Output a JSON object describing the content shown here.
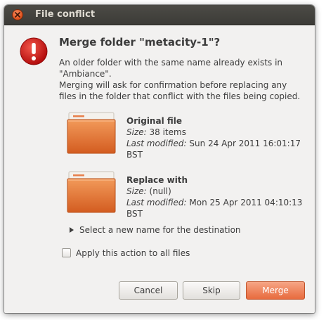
{
  "window": {
    "title": "File conflict"
  },
  "dialog": {
    "heading": "Merge folder \"metacity-1\"?",
    "message_line1": "An older folder with the same name already exists in \"Ambiance\".",
    "message_line2": "Merging will ask for confirmation before replacing any files in the folder that conflict with the files being copied."
  },
  "original": {
    "title": "Original file",
    "size_label": "Size:",
    "size_value": "38 items",
    "modified_label": "Last modified:",
    "modified_value": "Sun 24 Apr 2011 16:01:17 BST"
  },
  "replacement": {
    "title": "Replace with",
    "size_label": "Size:",
    "size_value": "(null)",
    "modified_label": "Last modified:",
    "modified_value": "Mon 25 Apr 2011 04:10:13 BST"
  },
  "expander": {
    "label": "Select a new name for the destination"
  },
  "apply_all": {
    "label": "Apply this action to all files",
    "checked": false
  },
  "buttons": {
    "cancel": "Cancel",
    "skip": "Skip",
    "merge": "Merge"
  },
  "icons": {
    "close": "close-icon",
    "error": "error-icon",
    "folder": "folder-icon",
    "expander": "triangle-right-icon"
  },
  "colors": {
    "accent": "#e86b3e",
    "error_red": "#d01717",
    "folder_orange": "#e2722f",
    "titlebar": "#3c3b37"
  }
}
